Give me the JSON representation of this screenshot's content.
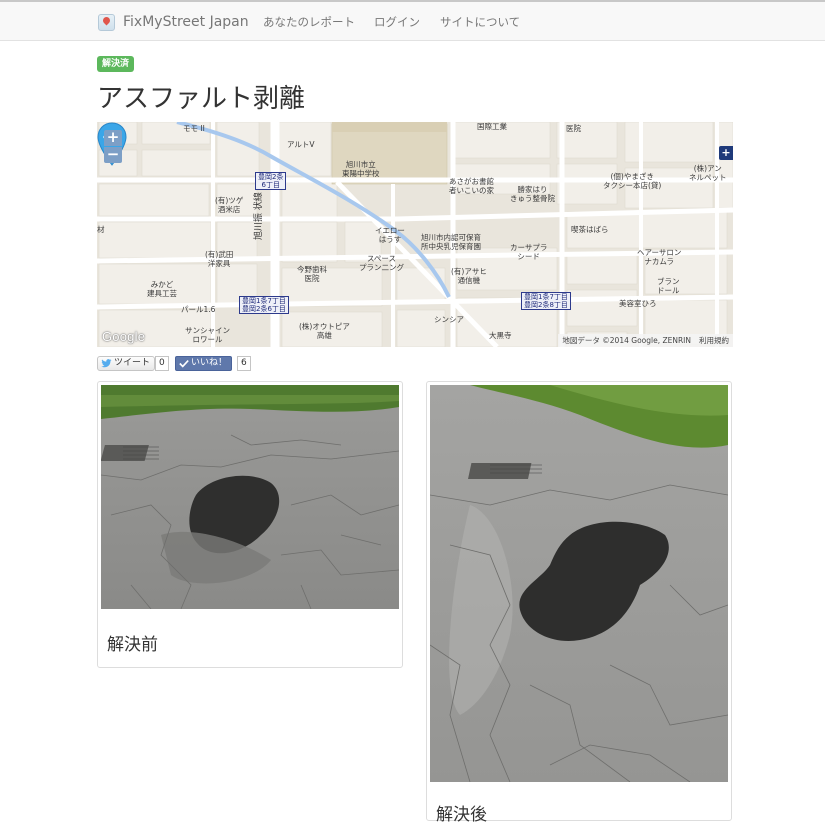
{
  "navbar": {
    "brand": "FixMyStreet Japan",
    "links": [
      "あなたのレポート",
      "ログイン",
      "サイトについて"
    ]
  },
  "report": {
    "status_badge": "解決済",
    "title": "アスファルト剥離"
  },
  "map": {
    "zoom_in": "+",
    "zoom_out": "−",
    "control": "+",
    "logo": "Google",
    "attribution": "地図データ ©2014 Google, ZENRIN",
    "terms": "利用規約",
    "labels": {
      "school": "旭川市立\n東陽中学校",
      "alto": "アルトV",
      "moto": "モモ II",
      "akiba": "あさがお書館\n者いこいの家",
      "katsuya": "勝家はり\nきゅう整骨院",
      "yamazaki": "(個)やまざき\nタクシー本店(貸)",
      "annerpet": "(株)アン\nネルペット",
      "tsuge": "(有)ツゲ\n酒米店",
      "takeda": "(有)武田\n洋家具",
      "yellow": "イエロー\nはうす",
      "hoikusho": "旭川市内認可保育\n所中央乳児保育園",
      "carsupra": "カーサプラ\nシード",
      "kissa": "喫茶はばら",
      "hairsalon": "ヘアーサロン\nナカムラ",
      "imano": "今野歯科\n医院",
      "space": "スペース\nプラン二ング",
      "asahi": "(有)アサヒ\n通信機",
      "brand": "ブラン\nドール",
      "biyoshitsu": "美容室ひろ",
      "mikado": "みかど\n建具工芸",
      "pearl": "パール1.6",
      "sunshine": "サンシャイン\nロワール",
      "otopia": "(株)オウトピア\n高雄",
      "shinshia": "シンシア",
      "daikokuji": "大黒寺",
      "railway": "旭川振 状線",
      "kanazai": "材",
      "hospital": "医院",
      "kokuji": "国際工業"
    },
    "signs": {
      "s1": "豊岡2条\n6丁目",
      "s2": "豊岡1条7丁目\n豊岡2条6丁目",
      "s3": "豊岡1条7丁目\n豊岡2条8丁目"
    }
  },
  "social": {
    "tweet_label": "ツイート",
    "tweet_count": "0",
    "like_label": "いいね！",
    "like_count": "6"
  },
  "photos": [
    {
      "caption": "解決前"
    },
    {
      "caption": "解決後"
    }
  ],
  "colors": {
    "badge": "#5cb85c",
    "pin": "#3aa6e8",
    "like": "#5f78ab",
    "map_road": "#ffffff",
    "map_block": "#e9e5dc",
    "map_river": "#a8c8ee"
  }
}
